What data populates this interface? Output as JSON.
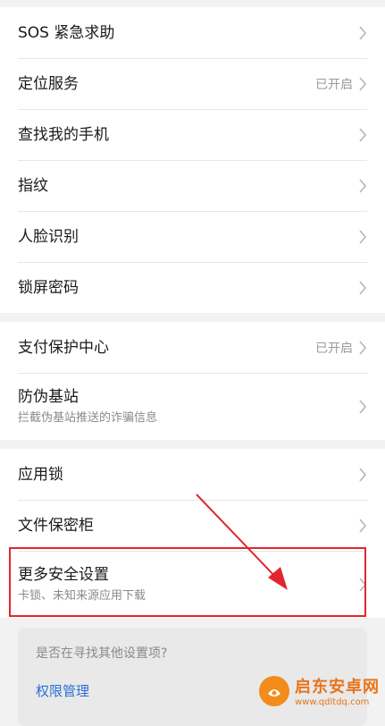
{
  "groups": [
    {
      "items": [
        {
          "label": "SOS 紧急求助"
        },
        {
          "label": "定位服务",
          "status": "已开启"
        },
        {
          "label": "查找我的手机"
        },
        {
          "label": "指纹"
        },
        {
          "label": "人脸识别"
        },
        {
          "label": "锁屏密码"
        }
      ]
    },
    {
      "items": [
        {
          "label": "支付保护中心",
          "status": "已开启"
        },
        {
          "label": "防伪基站",
          "subtitle": "拦截伪基站推送的诈骗信息"
        }
      ]
    },
    {
      "items": [
        {
          "label": "应用锁"
        },
        {
          "label": "文件保密柜"
        },
        {
          "label": "更多安全设置",
          "subtitle": "卡锁、未知来源应用下载"
        }
      ]
    }
  ],
  "suggestion": {
    "question": "是否在寻找其他设置项?",
    "link": "权限管理"
  },
  "watermark": {
    "title": "启东安卓网",
    "url": "www.qdltdq.com"
  },
  "colors": {
    "highlight_border": "#e0262e",
    "arrow": "#e0262e",
    "link": "#2a6fd6"
  }
}
